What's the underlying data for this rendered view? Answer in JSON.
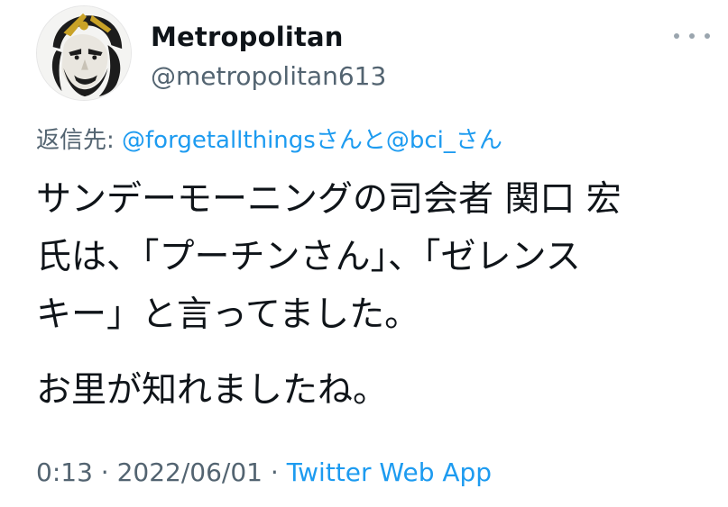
{
  "author": {
    "display_name": "Metropolitan",
    "handle": "@metropolitan613",
    "avatar_icon": "samurai-face-avatar"
  },
  "reply": {
    "prefix": "返信先: ",
    "mentions_text": "@forgetallthingsさんと@bci_さん"
  },
  "tweet": {
    "lines": [
      "サンデーモーニングの司会者 関口 宏",
      "氏は、「プーチンさん」、「ゼレンス",
      "キー」と言ってました。"
    ],
    "paragraph2": "お里が知れましたね。"
  },
  "meta": {
    "time": "0:13",
    "separator1": " · ",
    "date": "2022/06/01",
    "separator2": " · ",
    "source": "Twitter Web App"
  },
  "colors": {
    "text": "#0f1419",
    "secondary": "#536471",
    "link": "#1d9bf0"
  },
  "icons": {
    "more": "more-horizontal-icon"
  }
}
